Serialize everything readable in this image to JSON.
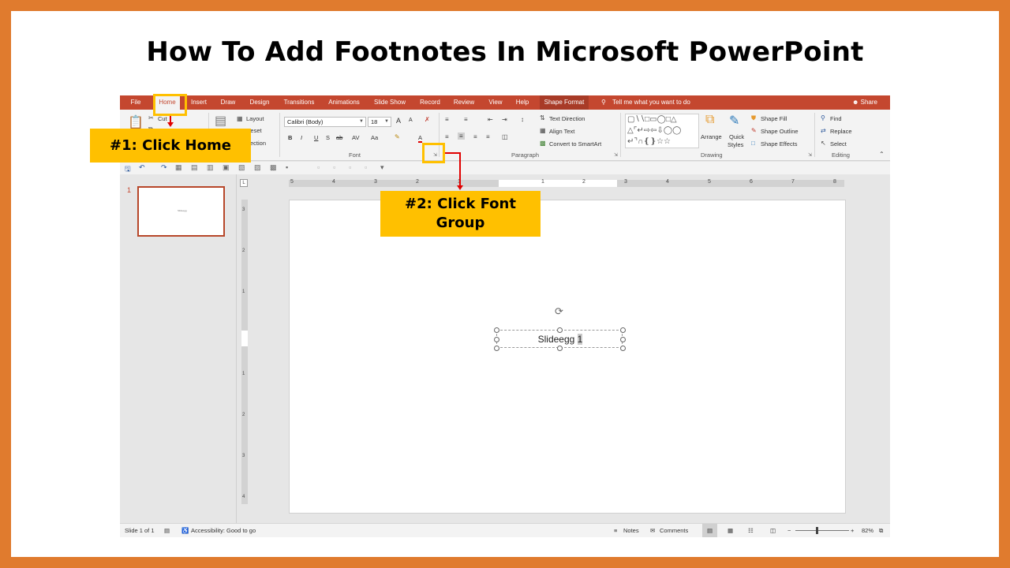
{
  "slide": {
    "title": "How To Add Footnotes In Microsoft PowerPoint"
  },
  "tabs": [
    "File",
    "Home",
    "Insert",
    "Draw",
    "Design",
    "Transitions",
    "Animations",
    "Slide Show",
    "Record",
    "Review",
    "View",
    "Help",
    "Shape Format"
  ],
  "active_tab": "Home",
  "tell_me": "Tell me what you want to do",
  "share": "Share",
  "ribbon": {
    "clipboard": {
      "cut": "Cut",
      "paste_icon": "paste-icon"
    },
    "slides": {
      "layout": "Layout",
      "reset": "Reset",
      "section": "Section"
    },
    "font": {
      "label": "Font",
      "font_name": "Calibri (Body)",
      "font_size": "18",
      "bold": "B",
      "italic": "I",
      "underline": "U",
      "strike": "S",
      "shadow": "ab",
      "grow": "A",
      "shrink": "A",
      "case": "Aa",
      "spacing": "AV",
      "color": "A"
    },
    "paragraph": {
      "label": "Paragraph",
      "text_direction": "Text Direction",
      "align_text": "Align Text",
      "convert_smartart": "Convert to SmartArt"
    },
    "drawing": {
      "label": "Drawing",
      "arrange": "Arrange",
      "quick_styles_1": "Quick",
      "quick_styles_2": "Styles",
      "shape_fill": "Shape Fill",
      "shape_outline": "Shape Outline",
      "shape_effects": "Shape Effects"
    },
    "editing": {
      "label": "Editing",
      "find": "Find",
      "replace": "Replace",
      "select": "Select"
    }
  },
  "thumbnails": [
    {
      "number": "1",
      "text": "Slideegg"
    }
  ],
  "ruler": {
    "h_labels": [
      "5",
      "4",
      "3",
      "2",
      "1",
      "1",
      "2",
      "3",
      "4",
      "5",
      "6",
      "7",
      "8"
    ],
    "v_labels": [
      "3",
      "2",
      "1",
      "1",
      "2",
      "3",
      "4"
    ]
  },
  "canvas": {
    "textbox_text": "Slideegg ",
    "textbox_selected": "1"
  },
  "status": {
    "slide_count": "Slide 1 of 1",
    "accessibility": "Accessibility: Good to go",
    "notes": "Notes",
    "comments": "Comments",
    "zoom": "82%"
  },
  "callouts": {
    "step1": "#1: Click Home",
    "step2_line1": "#2: Click Font",
    "step2_line2": "Group"
  },
  "colors": {
    "frame": "#e07b2e",
    "tabbar": "#c4472f",
    "callout": "#ffc000",
    "arrow": "#e00000"
  }
}
